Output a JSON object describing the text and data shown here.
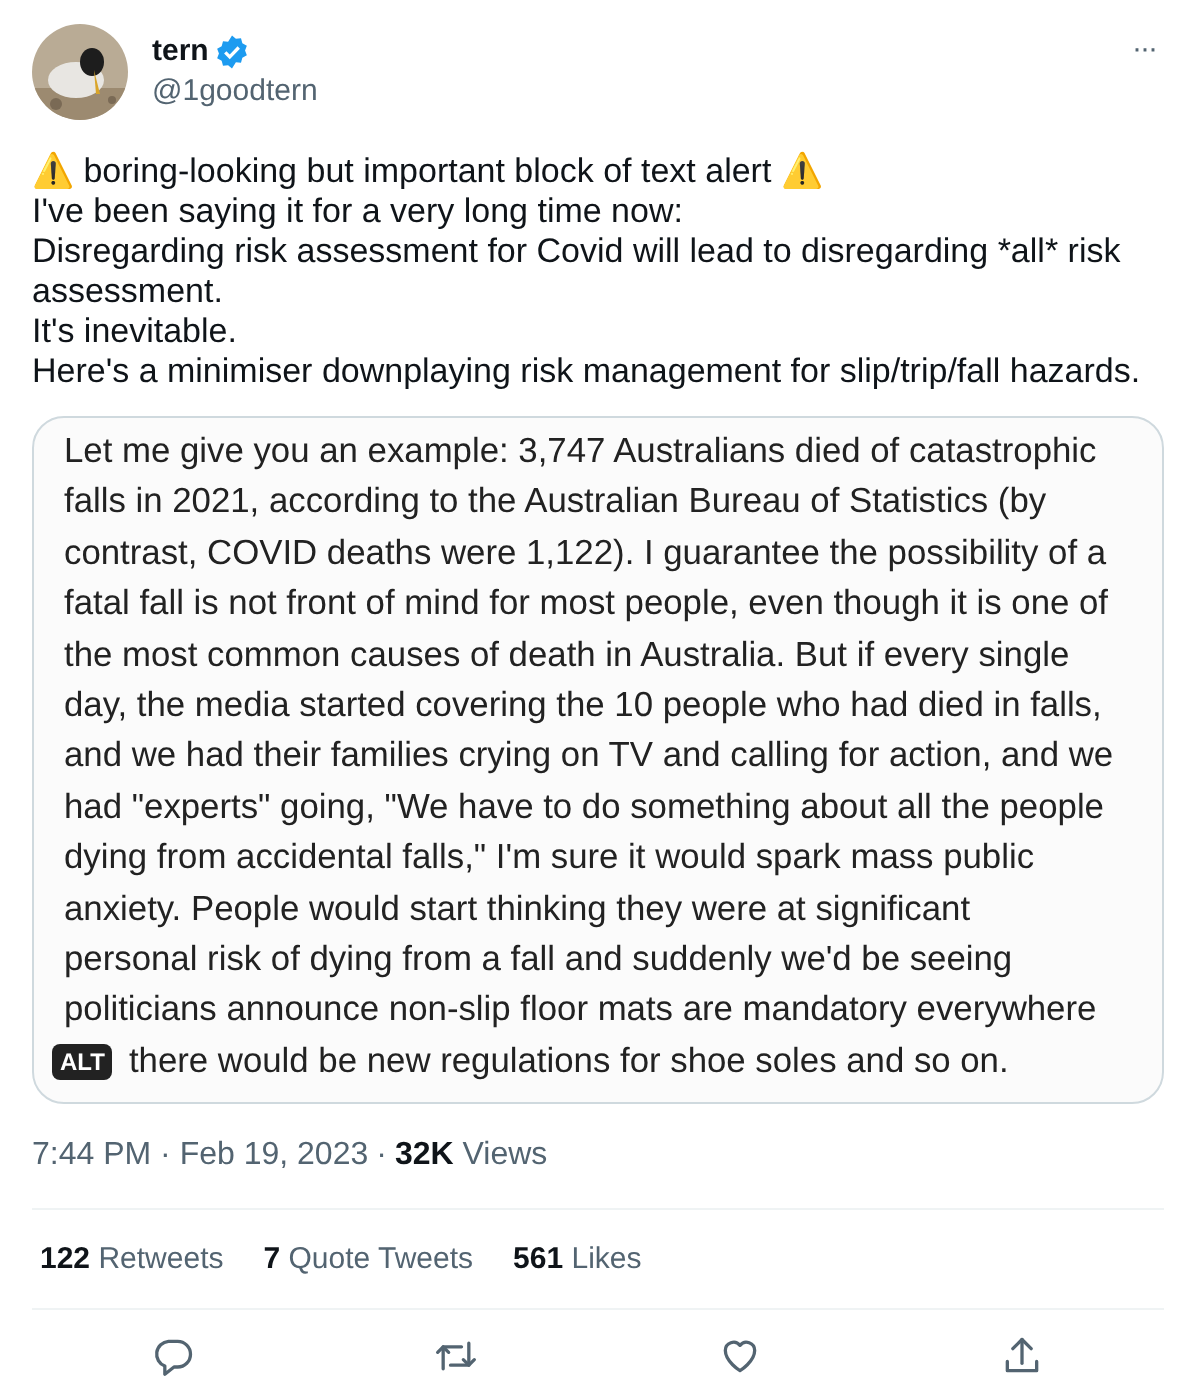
{
  "author": {
    "name": "tern",
    "verified": true,
    "handle": "@1goodtern"
  },
  "more_label": "···",
  "text_lines": [
    "⚠️ boring-looking but important block of text alert ⚠️",
    "I've been saying it for a very long time now:",
    "Disregarding risk assessment for Covid will lead to disregarding *all* risk assessment.",
    "It's inevitable.",
    "Here's a minimiser downplaying risk management for slip/trip/fall hazards."
  ],
  "image": {
    "lines": [
      "Let me give you an example: 3,747 Australians died of catastrophic",
      "falls in 2021, according to the Australian Bureau of Statistics (by",
      "contrast, COVID deaths were 1,122). I guarantee the possibility of a",
      "fatal fall is not front of mind for most people, even though it is one of",
      "the most common causes of death in Australia. But if every single",
      "day, the media started covering the 10 people who had died in falls,",
      "and we had their families crying on TV and calling for action, and we",
      "had \"experts\" going, \"We have to do something about all the people",
      "dying from accidental falls,\" I'm sure it would spark mass public",
      "anxiety. People would start thinking they were at significant",
      "personal risk of dying from a fall and suddenly we'd be seeing",
      "politicians announce non-slip floor mats are mandatory everywhere",
      "there would be new regulations for shoe soles and so on."
    ],
    "alt_badge": "ALT"
  },
  "meta": {
    "time": "7:44 PM",
    "separator": "·",
    "date": "Feb 19, 2023",
    "views_count": "32K",
    "views_label": "Views"
  },
  "stats": [
    {
      "count": "122",
      "label": "Retweets"
    },
    {
      "count": "7",
      "label": "Quote Tweets"
    },
    {
      "count": "561",
      "label": "Likes"
    }
  ],
  "actions": [
    {
      "kind": "reply"
    },
    {
      "kind": "retweet"
    },
    {
      "kind": "like"
    },
    {
      "kind": "share"
    }
  ]
}
